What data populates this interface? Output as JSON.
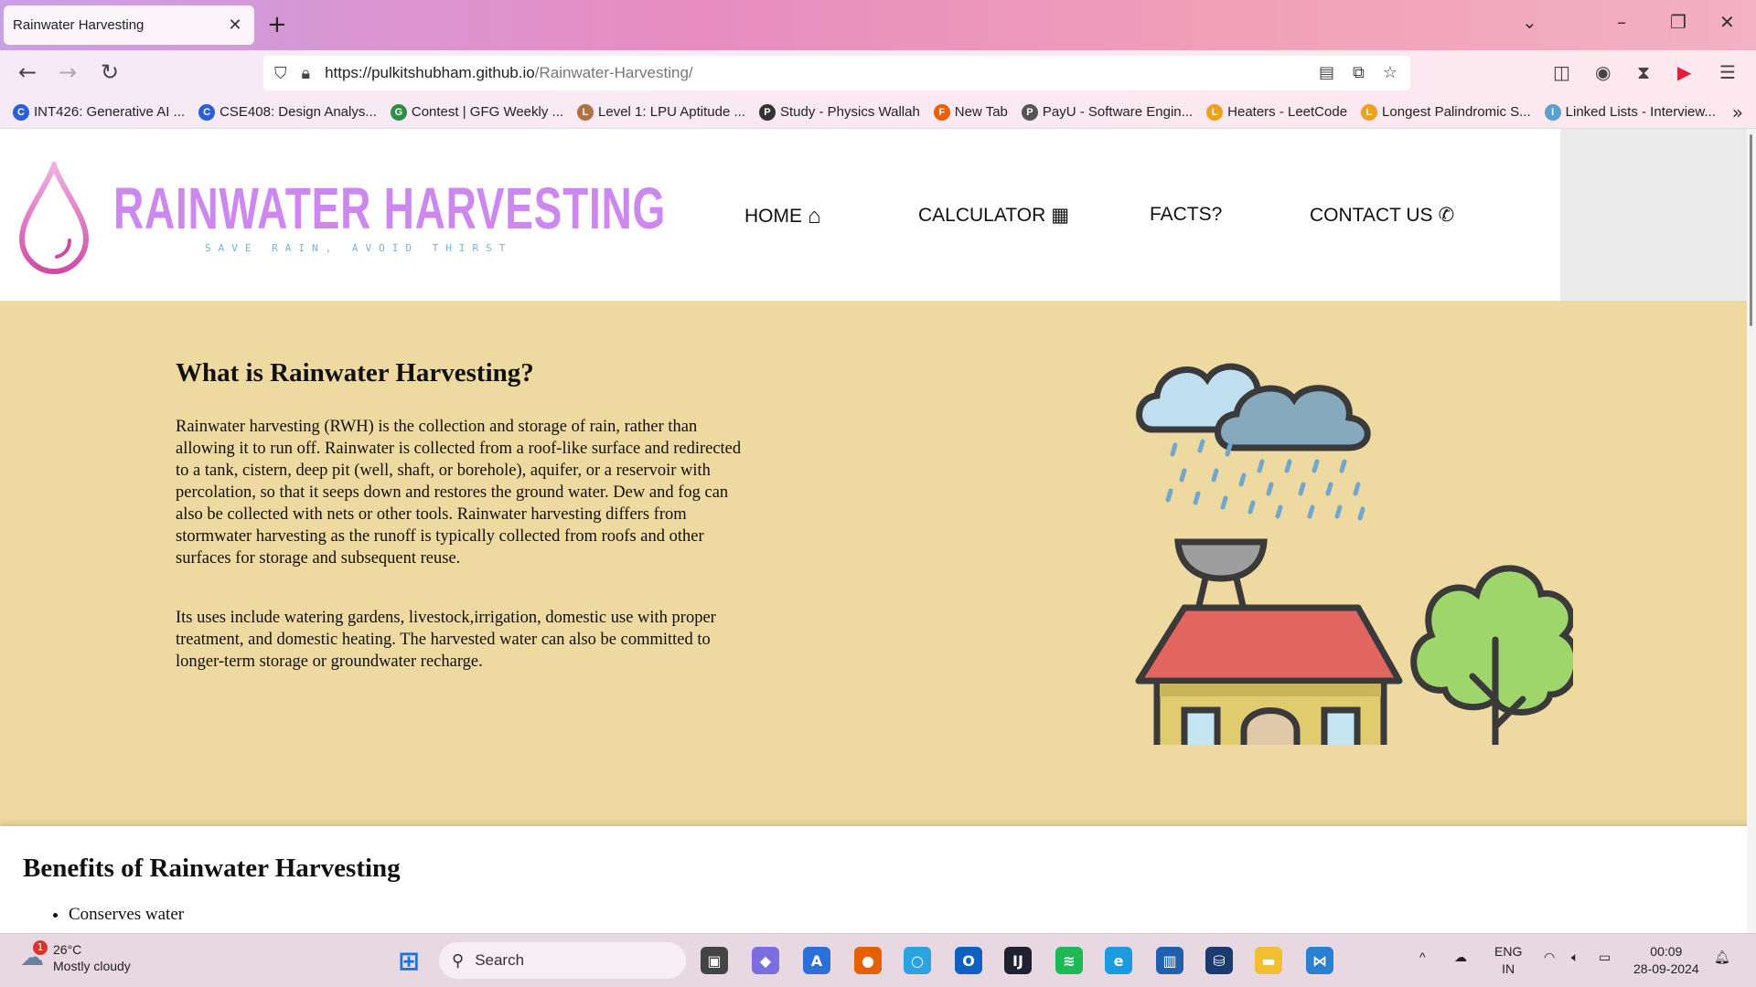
{
  "browser": {
    "tab_title": "Rainwater Harvesting",
    "tab_close": "✕",
    "new_tab": "+",
    "url_host": "https://pulkitshubham.github.io",
    "url_path": "/Rainwater-Harvesting/",
    "bookmarks": [
      {
        "label": "INT426: Generative AI ...",
        "color": "#2b5fd9",
        "glyph": "C"
      },
      {
        "label": "CSE408: Design Analys...",
        "color": "#2b5fd9",
        "glyph": "C"
      },
      {
        "label": "Contest | GFG Weekly ...",
        "color": "#2f8d46",
        "glyph": "G"
      },
      {
        "label": "Level 1: LPU Aptitude ...",
        "color": "#b07040",
        "glyph": "L"
      },
      {
        "label": "Study - Physics Wallah",
        "color": "#333333",
        "glyph": "P"
      },
      {
        "label": "New Tab",
        "color": "#e66000",
        "glyph": "F"
      },
      {
        "label": "PayU - Software Engin...",
        "color": "#555555",
        "glyph": "P"
      },
      {
        "label": "Heaters - LeetCode",
        "color": "#f0a020",
        "glyph": "L"
      },
      {
        "label": "Longest Palindromic S...",
        "color": "#f0a020",
        "glyph": "L"
      },
      {
        "label": "Linked Lists - Interview...",
        "color": "#5aa0d0",
        "glyph": "I"
      }
    ]
  },
  "site": {
    "logo_title": "RAINWATER HARVESTING",
    "logo_tagline": "SAVE RAIN, AVOID THIRST",
    "nav": [
      {
        "label": "HOME",
        "icon": "⌂"
      },
      {
        "label": "CALCULATOR",
        "icon": "▦"
      },
      {
        "label": "FACTS?",
        "icon": ""
      },
      {
        "label": "CONTACT US",
        "icon": "✆"
      }
    ]
  },
  "about": {
    "heading": "What is Rainwater Harvesting?",
    "para1": "Rainwater harvesting (RWH) is the collection and storage of rain, rather than allowing it to run off. Rainwater is collected from a roof-like surface and redirected to a tank, cistern, deep pit (well, shaft, or borehole), aquifer, or a reservoir with percolation, so that it seeps down and restores the ground water. Dew and fog can also be collected with nets or other tools. Rainwater harvesting differs from stormwater harvesting as the runoff is typically collected from roofs and other surfaces for storage and subsequent reuse.",
    "para2": "Its uses include watering gardens, livestock,irrigation, domestic use with proper treatment, and domestic heating. The harvested water can also be committed to longer-term storage or groundwater recharge."
  },
  "benefits": {
    "heading": "Benefits of Rainwater Harvesting",
    "items": [
      "Conserves water"
    ]
  },
  "taskbar": {
    "temperature": "26°C",
    "weather": "Mostly cloudy",
    "weather_badge": "1",
    "search_placeholder": "Search",
    "lang_top": "ENG",
    "lang_bottom": "IN",
    "time": "00:09",
    "date": "28-09-2024"
  },
  "colors": {
    "about_bg": "#eed9a0",
    "logo_purple": "#cc88ee",
    "tagline_blue": "#7ab0d8"
  }
}
